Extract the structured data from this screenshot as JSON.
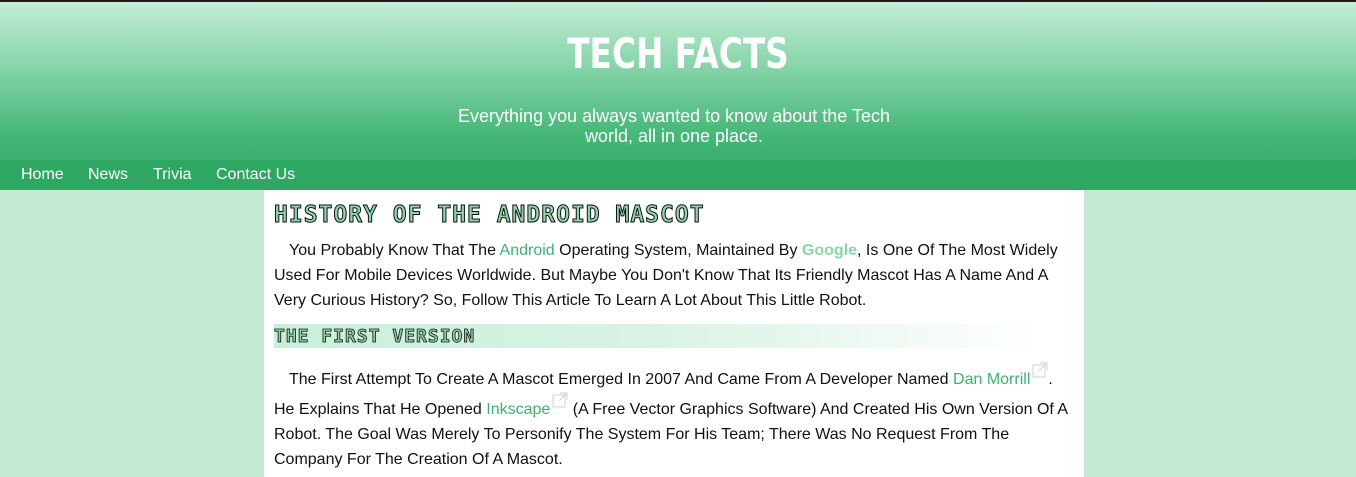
{
  "header": {
    "title": "TECH FACTS",
    "tagline_line1": "Everything you always wanted to know about the Tech",
    "tagline_line2": "world, all in one place."
  },
  "nav": {
    "items": [
      {
        "label": "Home"
      },
      {
        "label": "News"
      },
      {
        "label": "Trivia"
      },
      {
        "label": "Contact Us"
      }
    ]
  },
  "article": {
    "title": "HISTORY OF THE ANDROID MASCOT",
    "intro": {
      "t1": "You Probably Know That The ",
      "link1": "Android",
      "t2": " Operating System, Maintained By ",
      "link2": "Google",
      "t3": ", Is One Of The Most Widely Used For Mobile Devices Worldwide. But Maybe You Don't Know That Its Friendly Mascot Has A Name And A Very Curious History? So, Follow This Article To Learn A Lot About This Little Robot."
    },
    "section1": {
      "heading": "THE FIRST VERSION",
      "t1": "The First Attempt To Create A Mascot Emerged In 2007 And Came From A Developer Named ",
      "link1": "Dan Morrill",
      "t2": ". He Explains That He Opened ",
      "link2": "Inkscape",
      "t3": " (A Free Vector Graphics Software) And Created His Own Version Of A Robot. The Goal Was Merely To Personify The System For His Team; There Was No Request From The Company For The Creation Of A Mascot."
    }
  },
  "colors": {
    "accent": "#2ea762",
    "link": "#3cb371",
    "page_bg": "#c4ead5"
  },
  "icons": {
    "external_link": "external-link-icon"
  }
}
